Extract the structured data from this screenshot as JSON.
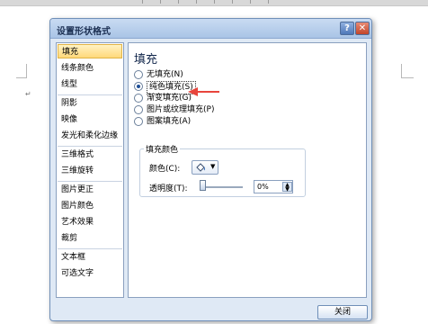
{
  "dialog": {
    "title": "设置形状格式",
    "help_glyph": "?",
    "close_glyph": "✕"
  },
  "nav": {
    "items": [
      {
        "label": "填充",
        "active": true
      },
      {
        "label": "线条颜色"
      },
      {
        "label": "线型"
      },
      {
        "label": "阴影"
      },
      {
        "label": "映像"
      },
      {
        "label": "发光和柔化边缘"
      },
      {
        "label": "三维格式"
      },
      {
        "label": "三维旋转"
      },
      {
        "label": "图片更正"
      },
      {
        "label": "图片颜色"
      },
      {
        "label": "艺术效果"
      },
      {
        "label": "裁剪"
      },
      {
        "label": "文本框"
      },
      {
        "label": "可选文字"
      }
    ]
  },
  "fill": {
    "heading": "填充",
    "options": [
      {
        "label": "无填充(N)",
        "checked": false
      },
      {
        "label": "纯色填充(S)",
        "checked": true
      },
      {
        "label": "渐变填充(G)",
        "checked": false
      },
      {
        "label": "图片或纹理填充(P)",
        "checked": false
      },
      {
        "label": "图案填充(A)",
        "checked": false
      }
    ],
    "group_title": "填充颜色",
    "color_label": "颜色(C):",
    "transparency_label": "透明度(T):",
    "transparency_value": "0%",
    "transparency_level": 0
  },
  "footer": {
    "close_label": "关闭"
  },
  "colors": {
    "arrow": "#e8453c",
    "active_nav": "#ffd87a"
  },
  "icons": [
    "help-icon",
    "close-icon",
    "paint-bucket-icon",
    "chevron-down-icon",
    "spin-up-icon",
    "spin-down-icon"
  ]
}
